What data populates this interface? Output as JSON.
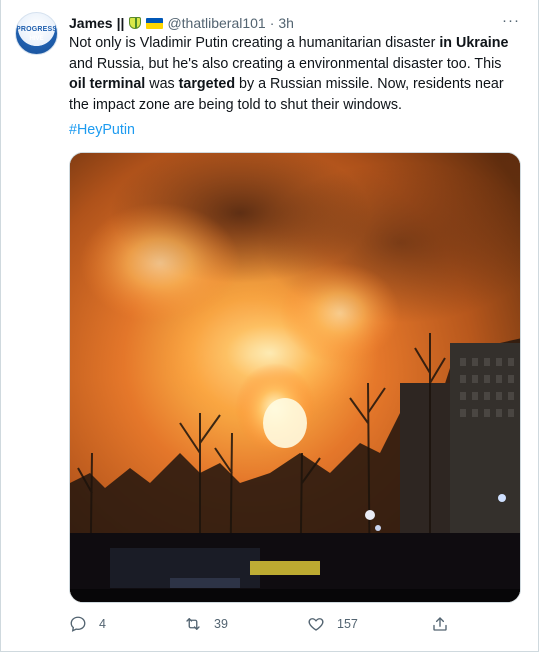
{
  "tweet": {
    "author_name": "James",
    "name_suffix": "||",
    "handle": "@thatliberal101",
    "separator": "·",
    "time": "3h",
    "more_label": "···",
    "avatar_text_top": "PROGRESS",
    "avatar_text_bottom": "HIVE",
    "text_parts": [
      {
        "t": "Not only is Vladimir Putin creating a humanitarian disaster ",
        "b": false
      },
      {
        "t": "in Ukraine",
        "b": true
      },
      {
        "t": " and Russia, but he's also creating a environmental disaster too. This ",
        "b": false
      },
      {
        "t": "oil terminal",
        "b": true
      },
      {
        "t": " was ",
        "b": false
      },
      {
        "t": "targeted",
        "b": true
      },
      {
        "t": " by a Russian missile. Now, residents near the impact zone are being told to shut their windows.",
        "b": false
      }
    ],
    "hashtag": "#HeyPutin",
    "media_description_icon": "fire-night-photo",
    "actions": {
      "reply_count": "4",
      "retweet_count": "39",
      "like_count": "157"
    }
  },
  "colors": {
    "accent": "#1d9bf0",
    "secondary_text": "#536471",
    "border": "#cfd9de"
  }
}
